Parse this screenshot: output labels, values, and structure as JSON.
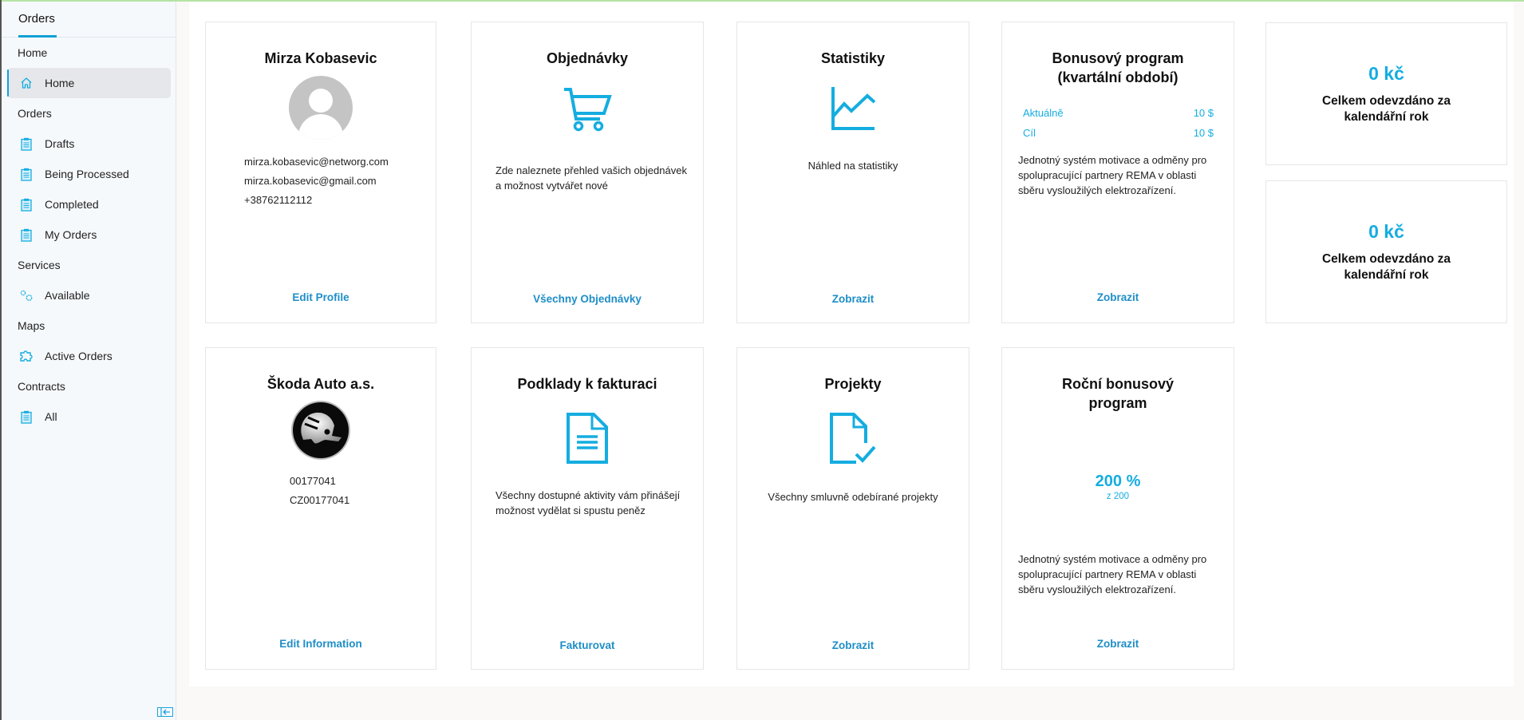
{
  "sidebar": {
    "tab": "Orders",
    "groups": [
      {
        "label": "Home",
        "items": [
          {
            "label": "Home",
            "icon": "home-icon",
            "active": true
          }
        ]
      },
      {
        "label": "Orders",
        "items": [
          {
            "label": "Drafts",
            "icon": "clipboard-icon"
          },
          {
            "label": "Being Processed",
            "icon": "clipboard-icon"
          },
          {
            "label": "Completed",
            "icon": "clipboard-icon"
          },
          {
            "label": "My Orders",
            "icon": "clipboard-icon"
          }
        ]
      },
      {
        "label": "Services",
        "items": [
          {
            "label": "Available",
            "icon": "gears-icon"
          }
        ]
      },
      {
        "label": "Maps",
        "items": [
          {
            "label": "Active Orders",
            "icon": "puzzle-icon"
          }
        ]
      },
      {
        "label": "Contracts",
        "items": [
          {
            "label": "All",
            "icon": "clipboard-icon"
          }
        ]
      }
    ],
    "collapse_icon": "collapse-left-icon"
  },
  "cards": {
    "profile": {
      "title": "Mirza Kobasevic",
      "email_work": "mirza.kobasevic@networg.com",
      "email_personal": "mirza.kobasevic@gmail.com",
      "phone": "+38762112112",
      "link": "Edit Profile"
    },
    "orders": {
      "title": "Objednávky",
      "icon": "cart-icon",
      "text": "Zde naleznete přehled vašich objednávek a možnost vytvářet nové",
      "link": "Všechny Objednávky"
    },
    "statistics": {
      "title": "Statistiky",
      "icon": "chart-line-icon",
      "text": "Náhled na statistiky",
      "link": "Zobrazit"
    },
    "bonus_quarter": {
      "title_line1": "Bonusový program",
      "title_line2": "(kvartální období)",
      "current_label": "Aktuálně",
      "current_value": "10 $",
      "target_label": "Cíl",
      "target_value": "10 $",
      "text": "Jednotný systém motivace a odměny pro spolupracující partnery REMA v oblasti sběru vysloužilých elektrozařízení.",
      "link": "Zobrazit"
    },
    "total1": {
      "amount": "0 kč",
      "label": "Celkem odevzdáno za kalendářní rok"
    },
    "total2": {
      "amount": "0 kč",
      "label": "Celkem odevzdáno za kalendářní rok"
    },
    "company": {
      "title": "Škoda Auto a.s.",
      "logo": "skoda-logo",
      "id": "00177041",
      "vat": "CZ00177041",
      "link": "Edit Information"
    },
    "invoicing": {
      "title": "Podklady k fakturaci",
      "icon": "document-icon",
      "text": "Všechny dostupné aktivity vám přinášejí možnost vydělat si spustu peněz",
      "link": "Fakturovat"
    },
    "projects": {
      "title": "Projekty",
      "icon": "document-check-icon",
      "text": "Všechny smluvně odebírané projekty",
      "link": "Zobrazit"
    },
    "bonus_year": {
      "title_line1": "Roční bonusový",
      "title_line2": "program",
      "percent": "200 %",
      "of": "z 200",
      "text": "Jednotný systém motivace a odměny pro spolupracující partnery REMA v oblasti sběru vysloužilých elektrozařízení.",
      "link": "Zobrazit"
    }
  },
  "colors": {
    "accent": "#15ade0",
    "link": "#1e8ec8",
    "active_bg": "#e5e7ea"
  }
}
